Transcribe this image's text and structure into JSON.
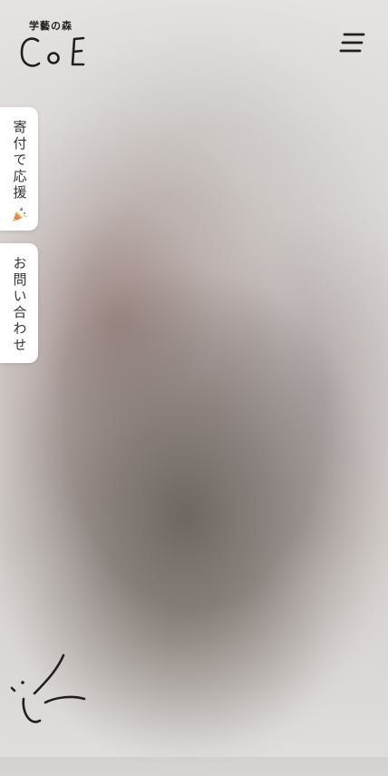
{
  "header": {
    "logo_subtitle": "学藝の森",
    "logo_wordmark": "CoE",
    "menu_icon": "hamburger-menu-icon"
  },
  "side_tabs": {
    "donate_label": "寄付で応援",
    "donate_icon": "party-popper-icon",
    "contact_label": "お問い合わせ"
  },
  "decoration": {
    "doodle_icon": "smiley-doodle-icon"
  },
  "colors": {
    "ink": "#1f1f1f",
    "tab_background": "#ffffff",
    "party_yellow": "#f2b630",
    "party_pink": "#e5557a"
  }
}
